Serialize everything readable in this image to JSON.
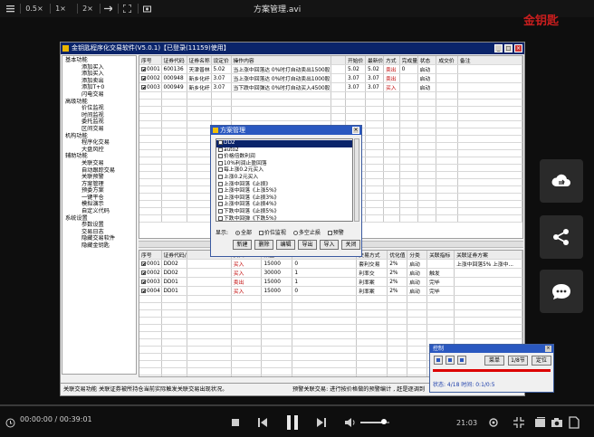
{
  "player": {
    "title": "方案管理.avi",
    "toolbar": [
      "0.5×",
      "1×",
      "2×"
    ],
    "time_current": "00:00:00",
    "time_total": "00:39:01",
    "clock": "21:03",
    "watermark": "金钥匙",
    "volume_level": 0.8,
    "progress": 0.0
  },
  "app": {
    "title": "金钥匙程序化交易软件(V5.0.1)【已登录(11159)使用】",
    "tree": [
      {
        "label": "基本功能",
        "group": true
      },
      {
        "label": "添加买入",
        "group": false
      },
      {
        "label": "添加买入",
        "group": false
      },
      {
        "label": "添加卖出",
        "group": false
      },
      {
        "label": "添加T+0",
        "group": false
      },
      {
        "label": "闪电交易",
        "group": false
      },
      {
        "label": "高级功能",
        "group": true
      },
      {
        "label": "价位监视",
        "group": false
      },
      {
        "label": "时间监视",
        "group": false
      },
      {
        "label": "委托监视",
        "group": false
      },
      {
        "label": "区间交易",
        "group": false
      },
      {
        "label": "机构功能",
        "group": true
      },
      {
        "label": "程序化交易",
        "group": false
      },
      {
        "label": "大盘风控",
        "group": false
      },
      {
        "label": "辅助功能",
        "group": true
      },
      {
        "label": "关联交易",
        "group": false
      },
      {
        "label": "自动跟踪交易",
        "group": false
      },
      {
        "label": "关联预警",
        "group": false
      },
      {
        "label": "方案管理",
        "group": false
      },
      {
        "label": "预委方案",
        "group": false
      },
      {
        "label": "一键平仓",
        "group": false
      },
      {
        "label": "模拟演示",
        "group": false
      },
      {
        "label": "自定义代码",
        "group": false
      },
      {
        "label": "系统设置",
        "group": true
      },
      {
        "label": "参数设置",
        "group": false
      },
      {
        "label": "交易日志",
        "group": false
      },
      {
        "label": "隐藏交易软件",
        "group": false
      },
      {
        "label": "隐藏金钥匙",
        "group": false
      }
    ],
    "top_grid": {
      "headers": [
        "序号",
        "证券代码",
        "证券名称",
        "设定价",
        "操作内容",
        "",
        "开始价",
        "最新价",
        "方式",
        "完成量",
        "状态",
        "成交价",
        "备注"
      ],
      "rows": [
        [
          "0001",
          "600136",
          "天津普林",
          "5.02",
          "当上涨中回落达 0%时打自动卖出1500股, 优化3%",
          "",
          "5.02",
          "5.02",
          "卖出",
          "0",
          "启动",
          "",
          ""
        ],
        [
          "0002",
          "000948",
          "新乡化纤",
          "3.07",
          "当上涨中回落达 0%时打自动卖出1000股, 优化3%",
          "",
          "3.07",
          "3.07",
          "卖出",
          "",
          "启动",
          "",
          ""
        ],
        [
          "0003",
          "000949",
          "新乡化纤",
          "3.07",
          "当下跌中回弹达 0%时打自动买入4500股, 优化3%",
          "",
          "3.07",
          "3.07",
          "买入",
          "",
          "启动",
          "",
          ""
        ]
      ]
    },
    "bottom_grid": {
      "headers": [
        "序号",
        "证券代码/名称",
        "",
        "买入",
        "数量",
        "",
        "交易方式",
        "优化值",
        "分类",
        "关联指标",
        "关联证券方案"
      ],
      "rows": [
        [
          "0001",
          "DD02",
          "",
          "买入",
          "15000",
          "0",
          "套利交易",
          "2%",
          "启动",
          "",
          "上涨中回落5% 上涨中..."
        ],
        [
          "0002",
          "DD02",
          "",
          "买入",
          "30000",
          "1",
          "利率交",
          "2%",
          "启动",
          "触发",
          ""
        ],
        [
          "0003",
          "DD01",
          "",
          "卖出",
          "15000",
          "1",
          "利率案",
          "2%",
          "启动",
          "完毕",
          ""
        ],
        [
          "0004",
          "DD01",
          "",
          "买入",
          "15000",
          "0",
          "利率案",
          "2%",
          "启动",
          "完毕",
          ""
        ]
      ]
    },
    "status_left": "关联交易功能 关联证券被所持仓当前实际触发关联交易出现状况。",
    "status_right": "预警关联交易: 进行按价格做的预警编计 , 赶是逐调到"
  },
  "dialog": {
    "title": "方案管理",
    "items": [
      "DD2",
      "auto2",
      "价格倍数利润",
      "10%利润止盈回落",
      "每上涨0.2元买入",
      "上涨0.2元买入",
      "上涨中回落《止损》",
      "上涨中回落《上涨5%》",
      "上涨中回落《止损3%》",
      "上涨中回落《止损4%》",
      "下跌中回落《止损5%》",
      "下跌中回弹《下跌5%》",
      "下跌中回弹《止损5%》",
      "下跌中回弹《止损7%》"
    ],
    "selected_index": 0,
    "show_label": "显示:",
    "radio_all": "全部",
    "check_price": "价位监视",
    "check_multi": "多空止损",
    "check_prewarn": "预警",
    "buttons": [
      "新建",
      "删除",
      "编辑",
      "导出",
      "导入",
      "关闭"
    ]
  },
  "mini_player": {
    "title": "控制",
    "btn_scheme": "菜单",
    "btn_page": "1/8节",
    "btn_locate": "定位",
    "status": "状态: 4/18  时间: 0:1/0:5"
  },
  "side_buttons": [
    "cloud-sync-icon",
    "share-icon",
    "chat-icon"
  ]
}
